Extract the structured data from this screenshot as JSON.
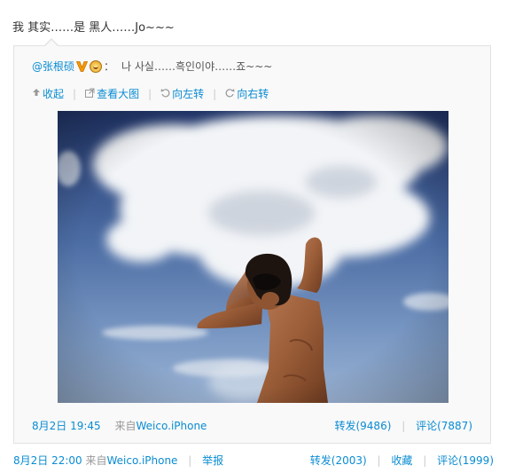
{
  "post": {
    "text": "我 其实……是 黑人……Jo~~~",
    "timestamp": "8月2日 22:00",
    "source_prefix": "来自",
    "source_app": "Weico.iPhone",
    "report_label": "举报",
    "repost_label": "转发(2003)",
    "favorite_label": "收藏",
    "comment_label": "评论(1999)"
  },
  "original": {
    "author": "@张根硕",
    "verified_icon": "verified-v-icon",
    "member_icon": "crown-badge-icon",
    "colon": "：",
    "text": "나 사실……흑인이야……죠~~~",
    "toolbar": {
      "collapse_label": "收起",
      "collapse_icon": "arrow-up-icon",
      "view_large_label": "查看大图",
      "view_large_icon": "external-image-icon",
      "rotate_left_label": "向左转",
      "rotate_left_icon": "rotate-left-icon",
      "rotate_right_label": "向右转",
      "rotate_right_icon": "rotate-right-icon"
    },
    "timestamp": "8月2日 19:45",
    "source_prefix": "来自",
    "source_app": "Weico.iPhone",
    "repost_label": "转发(9486)",
    "comment_label": "评论(7887)"
  },
  "colors": {
    "link": "#0a8cd2",
    "meta": "#999999",
    "box_bg": "#f9f9f9",
    "box_border": "#e2e2e2"
  }
}
